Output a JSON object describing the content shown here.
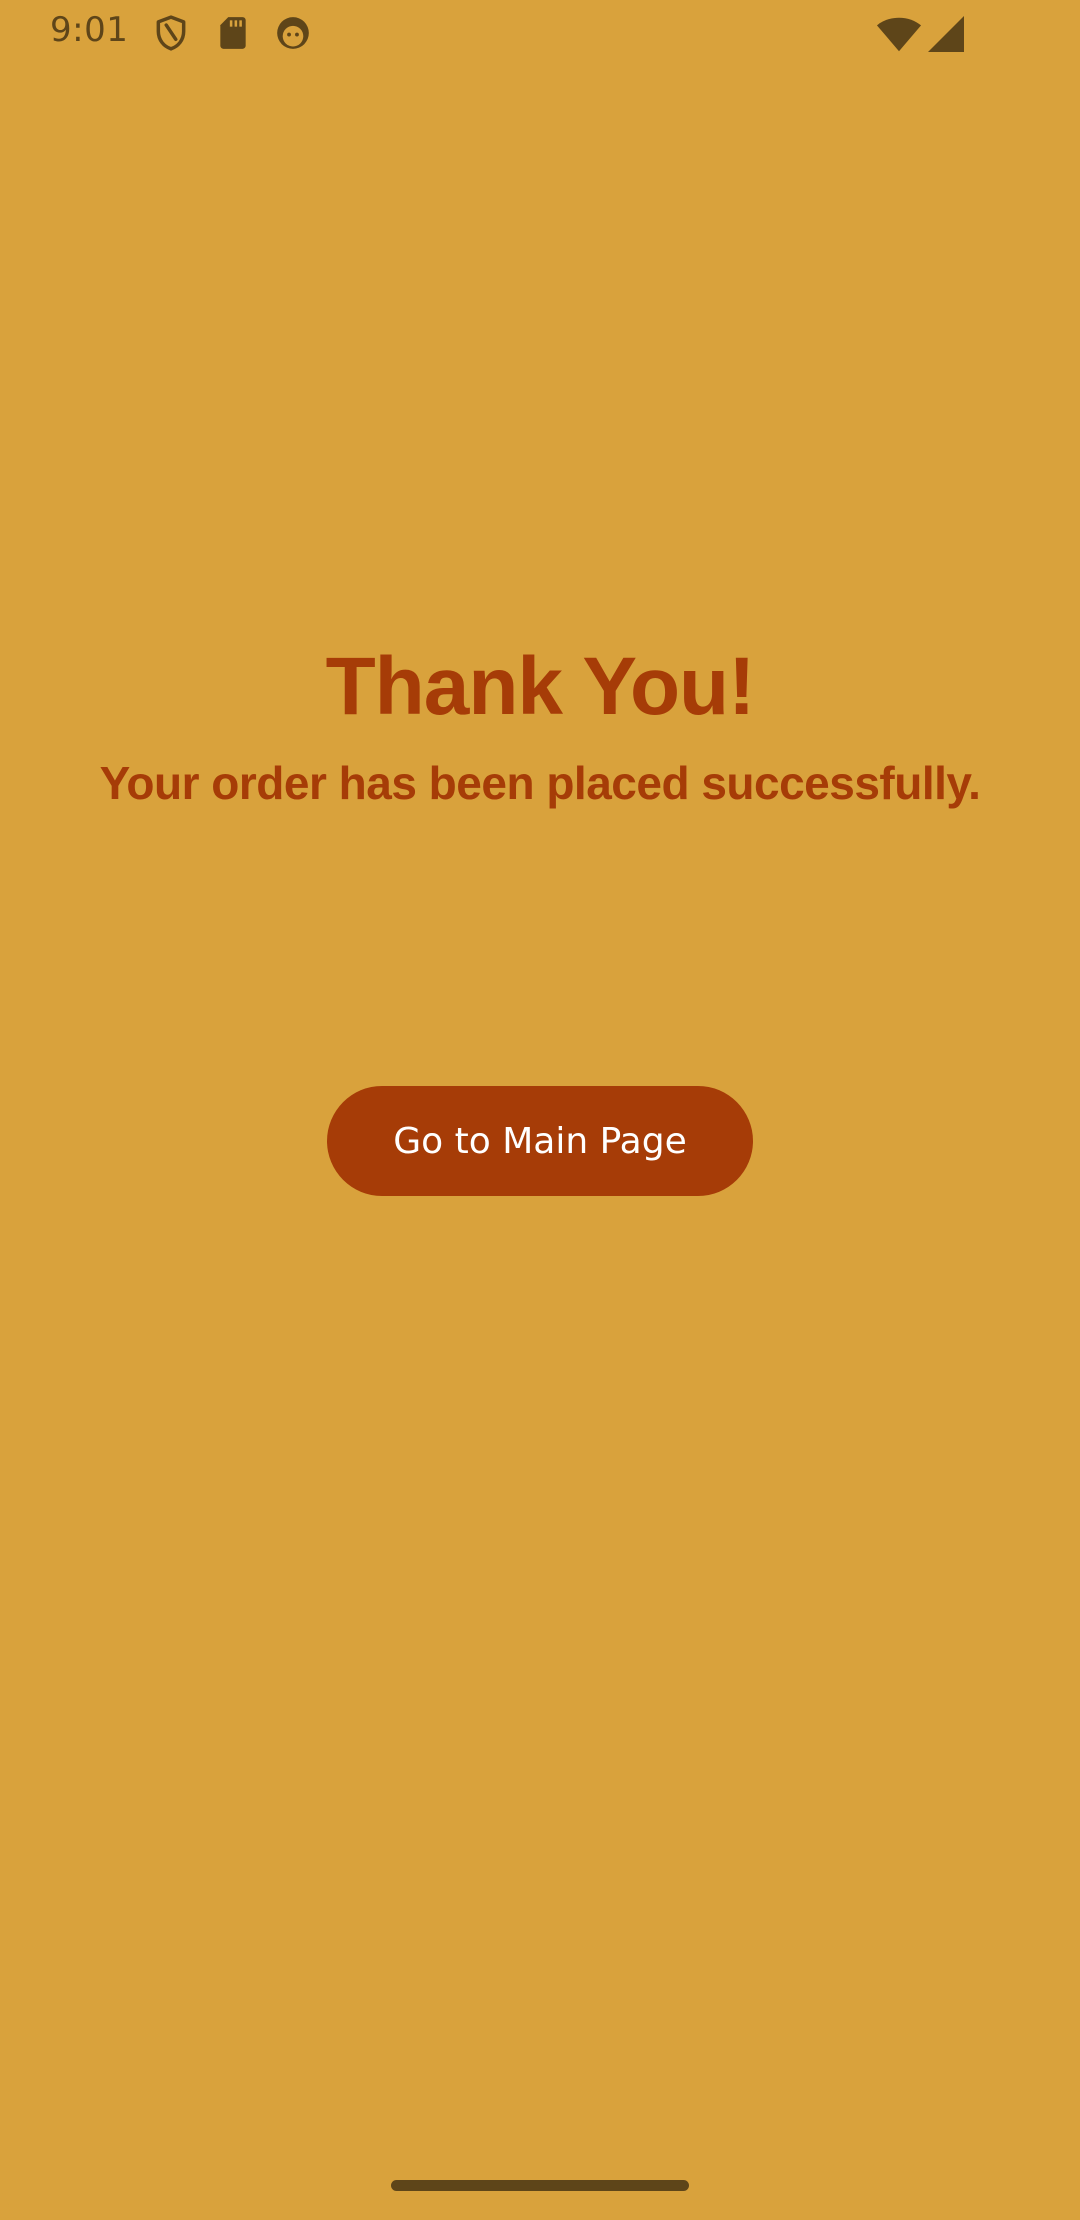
{
  "status_bar": {
    "time": "9:01",
    "icons": [
      "shield-icon",
      "sd-card-icon",
      "face-icon",
      "wifi-icon",
      "cell-signal-icon"
    ],
    "icon_color": "#5E4519"
  },
  "main": {
    "title": "Thank You!",
    "subtitle": "Your order has been placed successfully.",
    "button_label": "Go to Main Page"
  },
  "colors": {
    "background": "#D9A23C",
    "accent": "#A63C07",
    "button_text": "#FFFFFF"
  }
}
